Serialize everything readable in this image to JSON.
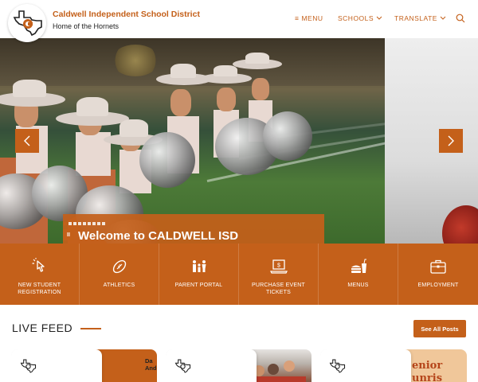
{
  "header": {
    "site_title": "Caldwell Independent School District",
    "site_subtitle": "Home of the Hornets",
    "nav": {
      "menu": "MENU",
      "schools": "SCHOOLS",
      "translate": "TRANSLATE"
    }
  },
  "hero": {
    "welcome_text": "Welcome to CALDWELL ISD",
    "pause_label": "II",
    "slide_count": 9,
    "active_slide": 1
  },
  "quick_links": [
    {
      "label": "NEW STUDENT REGISTRATION",
      "icon": "pointer-click-icon"
    },
    {
      "label": "ATHLETICS",
      "icon": "football-icon"
    },
    {
      "label": "PARENT PORTAL",
      "icon": "family-icon"
    },
    {
      "label": "PURCHASE EVENT TICKETS",
      "icon": "laptop-ticket-icon"
    },
    {
      "label": "MENUS",
      "icon": "food-drink-icon"
    },
    {
      "label": "EMPLOYMENT",
      "icon": "briefcase-icon"
    }
  ],
  "live_feed": {
    "title": "LIVE FEED",
    "see_all": "See All Posts",
    "cards": [
      {
        "image_text": "Da\nAnde"
      },
      {
        "image_text": ""
      },
      {
        "image_text": "enior\nunris"
      }
    ]
  },
  "colors": {
    "accent": "#c4601a",
    "text_dark": "#222222",
    "white": "#ffffff"
  }
}
